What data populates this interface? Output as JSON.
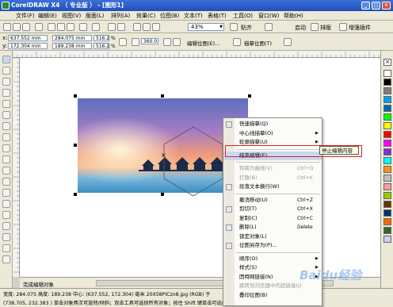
{
  "window": {
    "title": "CorelDRAW X4 （ 专业版 ） - [图形1]",
    "controls": [
      "_",
      "□",
      "×"
    ]
  },
  "menubar": [
    "文件(F)",
    "编辑(E)",
    "视图(V)",
    "版面(L)",
    "排列(A)",
    "效果(C)",
    "位图(B)",
    "文本(T)",
    "表格(T)",
    "工具(O)",
    "窗口(W)",
    "帮助(H)"
  ],
  "toolbar": {
    "zoom": "43%",
    "snap": "贴齐",
    "launch": "启动",
    "crop": "排版",
    "enhance": "增强插件"
  },
  "propbar": {
    "x": "637.552 mm",
    "y": "172.304 mm",
    "w": "284.075 mm",
    "h": "189.238 mm",
    "sx": "516.2",
    "sy": "516.2",
    "pct": "%",
    "angle": "360.0",
    "edit_btn": "编辑位图(E)...",
    "trace_btn": "描摹位图(T)"
  },
  "context_menu": {
    "items": [
      {
        "label": "快速描摹(Q)",
        "key": "",
        "arrow": false,
        "disabled": false
      },
      {
        "label": "中心线描摹(O)",
        "key": "",
        "arrow": true,
        "disabled": false
      },
      {
        "label": "轮廓描摹(U)",
        "key": "",
        "arrow": true,
        "disabled": false
      },
      {
        "sep": true
      },
      {
        "label": "结束编辑(E)",
        "key": "",
        "arrow": false,
        "disabled": false,
        "highlight": true
      },
      {
        "sep": true
      },
      {
        "label": "转换为曲线(V)",
        "key": "Ctrl+Q",
        "arrow": false,
        "disabled": true
      },
      {
        "label": "打散(B)",
        "key": "Ctrl+K",
        "arrow": false,
        "disabled": true
      },
      {
        "label": "段落文本换行(W)",
        "key": "",
        "arrow": false,
        "disabled": false
      },
      {
        "sep": true
      },
      {
        "label": "撤消移动(U)",
        "key": "Ctrl+Z",
        "arrow": false,
        "disabled": false
      },
      {
        "label": "剪切(T)",
        "key": "Ctrl+X",
        "arrow": false,
        "disabled": false
      },
      {
        "label": "复制(C)",
        "key": "Ctrl+C",
        "arrow": false,
        "disabled": false
      },
      {
        "label": "删除(L)",
        "key": "Delete",
        "arrow": false,
        "disabled": false
      },
      {
        "label": "锁定对象(L)",
        "key": "",
        "arrow": false,
        "disabled": false
      },
      {
        "label": "位图另存为(P)...",
        "key": "",
        "arrow": false,
        "disabled": false
      },
      {
        "sep": true
      },
      {
        "label": "顺序(O)",
        "key": "",
        "arrow": true,
        "disabled": false
      },
      {
        "label": "样式(S)",
        "key": "",
        "arrow": true,
        "disabled": false
      },
      {
        "label": "因特网链接(N)",
        "key": "",
        "arrow": true,
        "disabled": false
      },
      {
        "label": "跳转到浏览器中的超链接(J)",
        "key": "",
        "arrow": false,
        "disabled": true
      },
      {
        "label": "叠印位图(B)",
        "key": "",
        "arrow": false,
        "disabled": false
      }
    ]
  },
  "tooltip": "停止编辑内容",
  "page_tab": "完成编辑对象",
  "status": {
    "line1": "宽度: 284.075 高度: 189.238 中心: (637.552, 172.304) 毫米          20X58PICzn8.jpg (RGB) 于",
    "line2": "(738.705, 232.383 )    单击对象两次可旋转/倾斜；双击工具可选择所有对象；按住 Shift 键单击可选择"
  },
  "watermark": "Baidu经验",
  "palette": [
    "#ffffff",
    "#000000",
    "#7f7f7f",
    "#00a0e9",
    "#0068b7",
    "#00ff00",
    "#ffff00",
    "#ff0000",
    "#ff00ff",
    "#8a2be2",
    "#00ffff",
    "#f7941d",
    "#c0c0c0",
    "#ff9999",
    "#99cc00",
    "#663300",
    "#003366",
    "#ff6600",
    "#336633",
    "#ccccff"
  ]
}
